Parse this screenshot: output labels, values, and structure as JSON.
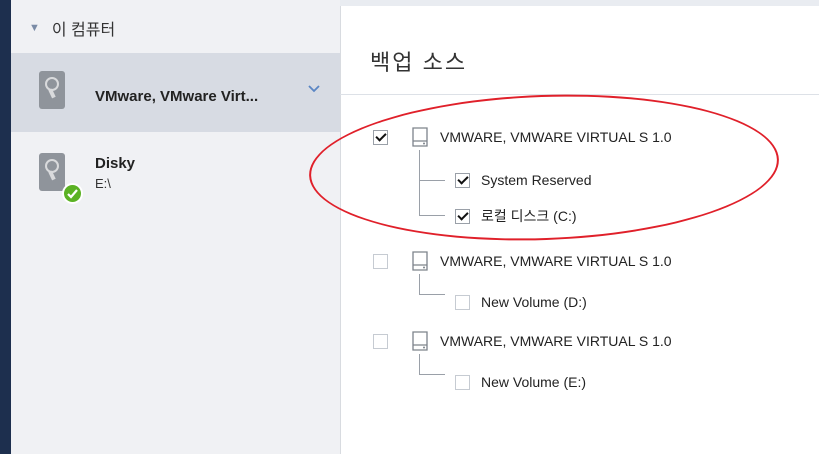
{
  "sidebar": {
    "header": "이 컴퓨터",
    "items": [
      {
        "name": "VMware, VMware Virt...",
        "selected": true,
        "icon": "hard-drive-icon"
      },
      {
        "name": "Disky",
        "subtitle": "E:\\",
        "status": "ok",
        "icon": "hard-drive-icon"
      }
    ]
  },
  "main": {
    "title": "백업 소스",
    "disks": [
      {
        "label": "VMWARE, VMWARE VIRTUAL S 1.0",
        "checked": true,
        "partitions": [
          {
            "label": "System Reserved",
            "checked": true
          },
          {
            "label": "로컬 디스크 (C:)",
            "checked": true
          }
        ]
      },
      {
        "label": "VMWARE, VMWARE VIRTUAL S 1.0",
        "checked": false,
        "partitions": [
          {
            "label": "New Volume (D:)",
            "checked": false
          }
        ]
      },
      {
        "label": "VMWARE, VMWARE VIRTUAL S 1.0",
        "checked": false,
        "partitions": [
          {
            "label": "New Volume (E:)",
            "checked": false
          }
        ]
      }
    ]
  },
  "colors": {
    "sidebar_bg": "#f0f1f4",
    "selected_bg": "#d7dbe3",
    "accent_dark": "#1d2f4e",
    "status_ok": "#5bb224",
    "annotation_circle": "#e0202a"
  }
}
